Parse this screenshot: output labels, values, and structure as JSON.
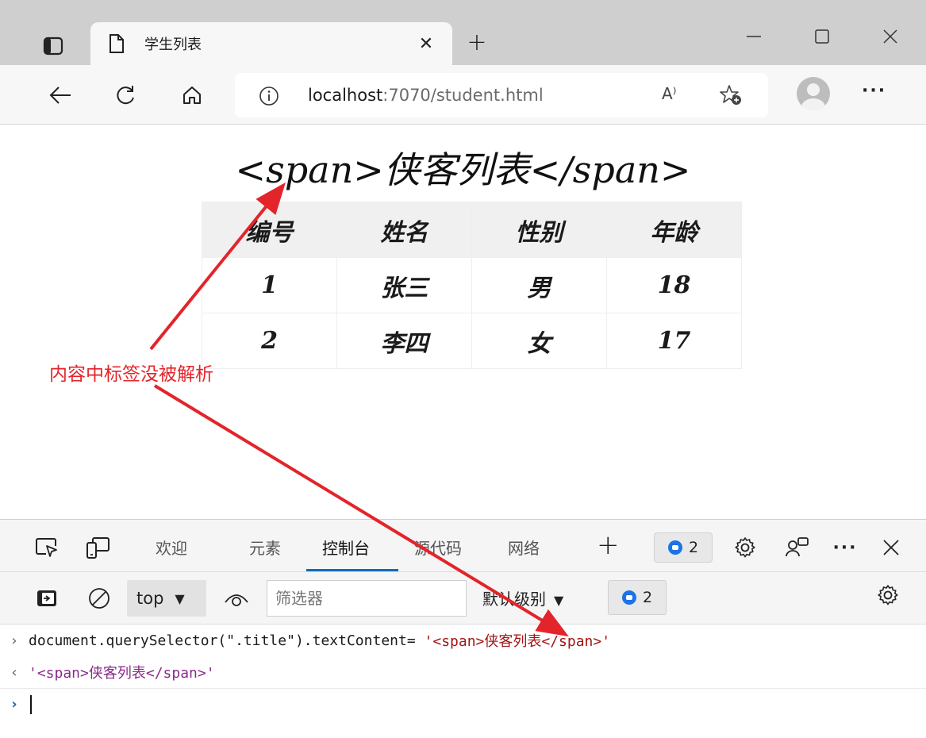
{
  "browser": {
    "tab_title": "学生列表",
    "url_host": "localhost",
    "url_rest": ":7070/student.html",
    "read_aloud": "A⁾"
  },
  "page": {
    "heading": "<span>侠客列表</span>",
    "table": {
      "headers": [
        "编号",
        "姓名",
        "性别",
        "年龄"
      ],
      "rows": [
        [
          "1",
          "张三",
          "男",
          "18"
        ],
        [
          "2",
          "李四",
          "女",
          "17"
        ]
      ]
    }
  },
  "devtools": {
    "tabs": [
      "欢迎",
      "元素",
      "控制台",
      "源代码",
      "网络"
    ],
    "active_tab": "控制台",
    "issues_count": "2",
    "console": {
      "context": "top",
      "filter_placeholder": "筛选器",
      "level_label": "默认级别",
      "issues_count": "2",
      "input_prefix": "document.querySelector(\".title\").textContent=",
      "input_string": "'<span>侠客列表</span>'",
      "result": "'<span>侠客列表</span>'"
    },
    "accent": "#0f6cbd"
  },
  "annotation": {
    "label": "内容中标签没被解析",
    "color": "#e3242b"
  }
}
